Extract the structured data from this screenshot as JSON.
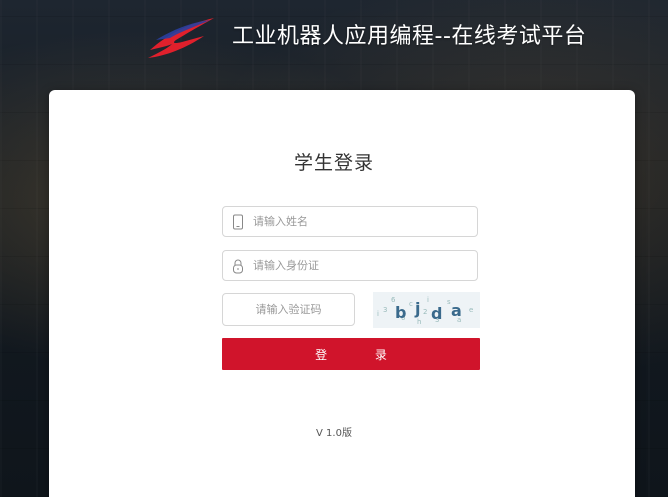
{
  "header": {
    "title": "工业机器人应用编程--在线考试平台",
    "logo_icon": "brand-swoosh-logo",
    "colors": {
      "logo_red": "#e0202c",
      "logo_blue": "#2a3fa0"
    }
  },
  "login": {
    "heading": "学生登录",
    "name_placeholder": "请输入姓名",
    "name_icon": "phone-icon",
    "id_placeholder": "请输入身份证",
    "id_icon": "lock-icon",
    "captcha_placeholder": "请输入验证码",
    "captcha_text": "bjda",
    "button_label": "登  录",
    "button_color": "#d0142b"
  },
  "footer": {
    "version": "V 1.0版"
  }
}
